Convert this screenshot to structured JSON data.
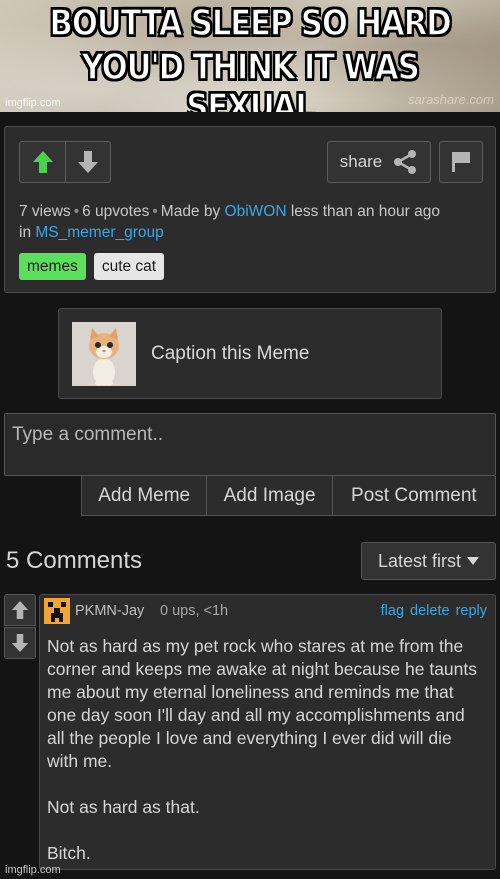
{
  "meme": {
    "line1": "BOUTTA SLEEP SO HARD",
    "line2": "YOU'D THINK IT WAS SEXUAL",
    "watermark": "imgflip.com",
    "site_watermark": "sarashare.com"
  },
  "post": {
    "share_label": "share",
    "views": "7 views",
    "upvotes": "6 upvotes",
    "made_by_prefix": "Made by",
    "author": "ObiWON",
    "time": "less than an hour ago",
    "in_prefix": "in",
    "stream": "MS_memer_group",
    "tags": [
      "memes",
      "cute cat"
    ]
  },
  "caption": {
    "label": "Caption this Meme"
  },
  "composer": {
    "placeholder": "Type a comment..",
    "buttons": [
      "Add Meme",
      "Add Image",
      "Post Comment"
    ]
  },
  "comments_section": {
    "title": "5 Comments",
    "sort_label": "Latest first"
  },
  "comment": {
    "username": "PKMN-Jay",
    "stats": "0 ups, <1h",
    "actions": [
      "flag",
      "delete",
      "reply"
    ],
    "paragraphs": [
      "Not as hard as my pet rock who stares at me from the corner and keeps me awake at night because he taunts me about my eternal loneliness and reminds me that one day soon I'll day and all my accomplishments and all the people I love and everything I ever did will die with me.",
      "Not as hard as that.",
      "Bitch."
    ]
  },
  "colors": {
    "accent_green": "#5ae05a",
    "link_blue": "#39a7e8",
    "background": "#141414",
    "panel": "#2c2c2c",
    "avatar_orange": "#f3a533"
  },
  "icons": [
    "up-arrow-icon",
    "down-arrow-icon",
    "share-icon",
    "flag-icon",
    "caret-down-icon",
    "kitten-thumbnail",
    "pixel-avatar-icon"
  ]
}
